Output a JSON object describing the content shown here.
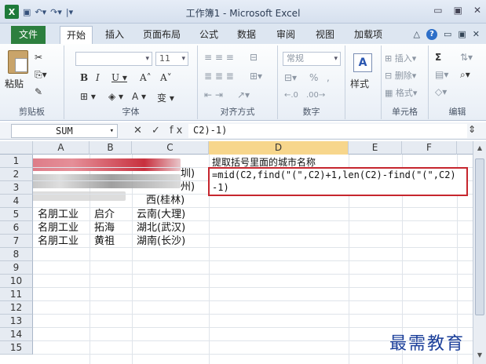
{
  "window": {
    "title": "工作簿1 - Microsoft Excel",
    "logo": "X",
    "qat": [
      "save-icon",
      "undo-icon",
      "redo-icon",
      "customize-icon"
    ],
    "controls": [
      "minimize-icon",
      "restore-icon",
      "close-icon"
    ]
  },
  "ribbon_tabs": {
    "file": "文件",
    "items": [
      "开始",
      "插入",
      "页面布局",
      "公式",
      "数据",
      "审阅",
      "视图",
      "加载项"
    ],
    "active": "开始"
  },
  "ribbon": {
    "clipboard": {
      "paste": "粘贴",
      "label": "剪贴板"
    },
    "font": {
      "size": "11",
      "label": "字体"
    },
    "alignment": {
      "label": "对齐方式"
    },
    "number": {
      "format": "常规",
      "percent": "%",
      "comma": ",",
      "label": "数字"
    },
    "styles": {
      "label": "样式"
    },
    "cells": {
      "insert": "插入",
      "delete": "删除",
      "format": "格式",
      "label": "单元格"
    },
    "editing": {
      "sum": "Σ",
      "label": "编辑"
    }
  },
  "formula_bar": {
    "name_box": "SUM",
    "icons": "✕ ✓ fx",
    "content": "C2)-1)"
  },
  "sheet": {
    "columns": [
      "A",
      "B",
      "C",
      "D",
      "E",
      "F"
    ],
    "active_column": "D",
    "rows": [
      "1",
      "2",
      "3",
      "4",
      "5",
      "6",
      "7",
      "8",
      "9",
      "10",
      "11",
      "12",
      "13",
      "14",
      "15"
    ],
    "d1_caption": "提取括号里面的城市名称",
    "visible_fragments": {
      "c2": "圳)",
      "c3": "州)",
      "c4": "西(桂林)"
    },
    "data": [
      {
        "row": "5",
        "a": "名朋工业",
        "b": "启介",
        "c": "云南(大理)"
      },
      {
        "row": "6",
        "a": "名朋工业",
        "b": "拓海",
        "c": "湖北(武汉)"
      },
      {
        "row": "7",
        "a": "名朋工业",
        "b": "黄祖",
        "c": "湖南(长沙)"
      }
    ],
    "edit_formula_line1": "=mid(C2,find(\"(\",C2)+1,len(C2)-find(\"(\",C2)",
    "edit_formula_line2": "-1)"
  },
  "watermark": "最需教育",
  "colors": {
    "file_tab": "#2c7f3e",
    "edit_border": "#c6262e",
    "watermark": "#1b3f9a",
    "active_header": "#f7d68c"
  }
}
